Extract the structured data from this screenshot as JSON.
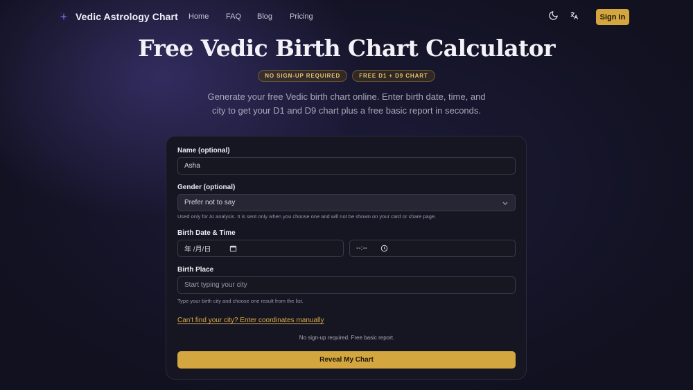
{
  "nav": {
    "logo_icon": "sparkle-logo-icon",
    "brand": "Vedic Astrology Chart",
    "links": [
      "Home",
      "FAQ",
      "Blog",
      "Pricing"
    ],
    "theme_icon": "moon-icon",
    "language_icon": "translate-icon",
    "signin": "Sign In"
  },
  "hero": {
    "title": "Free Vedic Birth Chart Calculator",
    "badges": [
      "NO SIGN-UP REQUIRED",
      "FREE D1 + D9 CHART"
    ],
    "subtitle": "Generate your free Vedic birth chart online. Enter birth date, time, and city to get your D1 and D9 chart plus a free basic report in seconds."
  },
  "form": {
    "name_label": "Name (optional)",
    "name_value": "Asha",
    "gender_label": "Gender (optional)",
    "gender_value": "Prefer not to say",
    "gender_hint": "Used only for AI analysis. It is sent only when you choose one and will not be shown on your card or share page.",
    "birth_label": "Birth Date & Time",
    "date_placeholder": "年 /月/日",
    "time_placeholder": "--:--",
    "place_label": "Birth Place",
    "place_placeholder": "Start typing your city",
    "place_hint": "Type your birth city and choose one result from the list.",
    "manual_link": "Can't find your city? Enter coordinates manually",
    "note": "No sign-up required. Free basic report.",
    "submit": "Reveal My Chart"
  },
  "colors": {
    "accent": "#d4a640",
    "background": "#111120",
    "card": "#161622",
    "link": "#d9aa48"
  }
}
